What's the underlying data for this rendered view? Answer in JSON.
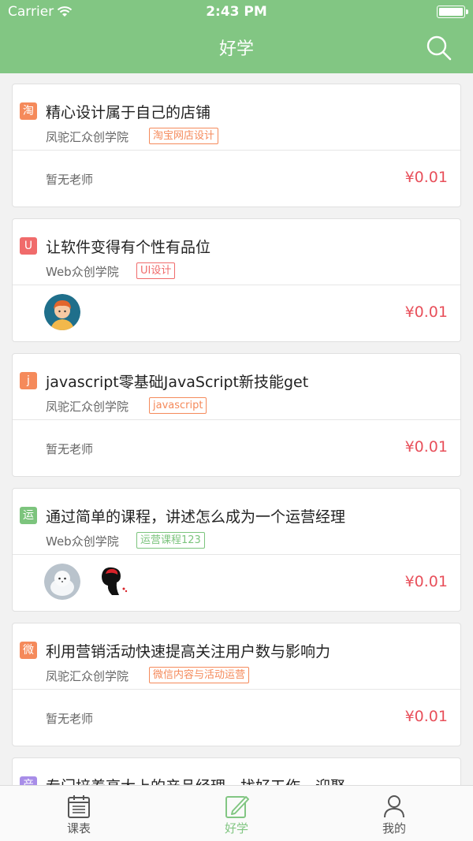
{
  "status_bar": {
    "carrier": "Carrier",
    "time": "2:43 PM"
  },
  "nav": {
    "title": "好学",
    "search_icon": "search-icon"
  },
  "colors": {
    "header": "#82c683",
    "price": "#e8505b",
    "orange": "#f58a5b",
    "red": "#f06b6b",
    "green": "#7cc47d",
    "purple": "#a88de8"
  },
  "courses": [
    {
      "badge": "淘",
      "badge_color": "#f58a5b",
      "title": "精心设计属于自己的店铺",
      "school": "凤驼汇众创学院",
      "tag": "淘宝网店设计",
      "tag_color": "#f58a5b",
      "teacher": "暂无老师",
      "price": "¥0.01"
    },
    {
      "badge": "U",
      "badge_color": "#f06b6b",
      "title": "让软件变得有个性有品位",
      "school": "Web众创学院",
      "tag": "UI设计",
      "tag_color": "#f06b6b",
      "teacher": "",
      "price": "¥0.01"
    },
    {
      "badge": "j",
      "badge_color": "#f58a5b",
      "title": "javascript零基础JavaScript新技能get",
      "school": "凤驼汇众创学院",
      "tag": "javascript",
      "tag_color": "#f58a5b",
      "teacher": "暂无老师",
      "price": "¥0.01"
    },
    {
      "badge": "运",
      "badge_color": "#7cc47d",
      "title": "通过简单的课程，讲述怎么成为一个运营经理",
      "school": "Web众创学院",
      "tag": "运营课程123",
      "tag_color": "#7cc47d",
      "teacher": "",
      "price": "¥0.01"
    },
    {
      "badge": "微",
      "badge_color": "#f58a5b",
      "title": "利用营销活动快速提高关注用户数与影响力",
      "school": "凤驼汇众创学院",
      "tag": "微信内容与活动运营",
      "tag_color": "#f58a5b",
      "teacher": "暂无老师",
      "price": "¥0.01"
    },
    {
      "badge": "产",
      "badge_color": "#a88de8",
      "title": "专门培养高大上的产品经理，找好工作，迎娶",
      "school": "",
      "tag": "",
      "tag_color": "#a88de8",
      "teacher": "",
      "price": ""
    }
  ],
  "tabs": [
    {
      "label": "课表",
      "icon": "calendar-icon"
    },
    {
      "label": "好学",
      "icon": "pen-note-icon"
    },
    {
      "label": "我的",
      "icon": "person-icon"
    }
  ]
}
